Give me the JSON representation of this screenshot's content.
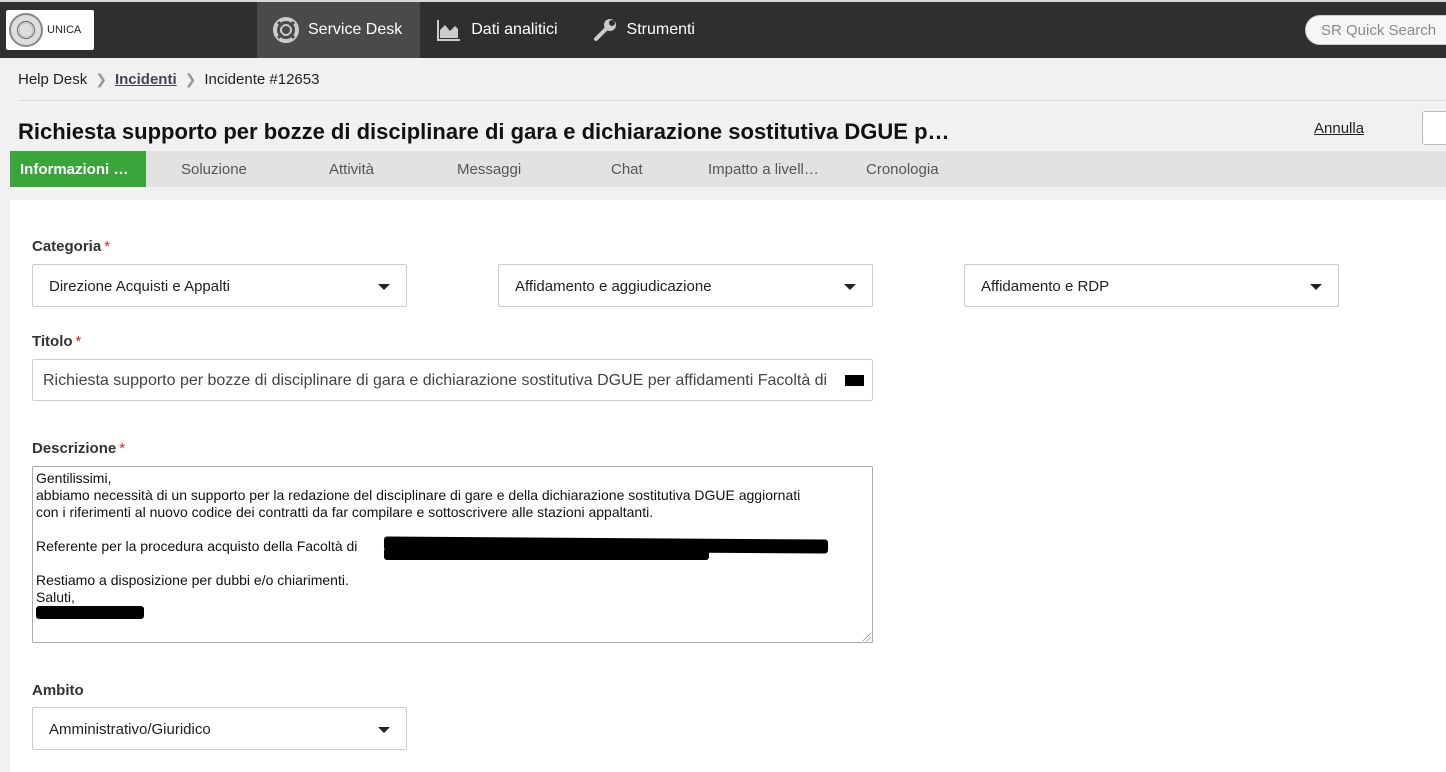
{
  "header": {
    "logo_text": "UNICA",
    "nav": [
      {
        "label": "Service Desk",
        "icon": "lifebuoy-icon"
      },
      {
        "label": "Dati analitici",
        "icon": "area-chart-icon"
      },
      {
        "label": "Strumenti",
        "icon": "wrench-icon"
      }
    ],
    "quick_search_placeholder": "SR Quick Search"
  },
  "breadcrumb": [
    "Help Desk",
    "Incidenti",
    "Incidente #12653"
  ],
  "page": {
    "title": "Richiesta supporto per bozze di disciplinare di gara e dichiarazione sostitutiva DGUE p…",
    "cancel_label": "Annulla"
  },
  "tabs": [
    "Informazioni …",
    "Soluzione",
    "Attività",
    "Messaggi",
    "Chat",
    "Impatto a livell…",
    "Cronologia"
  ],
  "form": {
    "categoria": {
      "label": "Categoria",
      "required_mark": "*",
      "values": [
        "Direzione Acquisti e Appalti",
        "Affidamento e aggiudicazione",
        "Affidamento e RDP"
      ]
    },
    "titolo": {
      "label": "Titolo",
      "required_mark": "*",
      "value": "Richiesta supporto per bozze di disciplinare di gara e dichiarazione sostitutiva DGUE per affidamenti Facoltà di "
    },
    "descrizione": {
      "label": "Descrizione",
      "required_mark": "*",
      "lines": [
        "Gentilissimi,",
        "abbiamo necessità di un supporto per la redazione del disciplinare di gare e della dichiarazione sostitutiva DGUE aggiornati",
        "con i riferimenti al nuovo codice dei contratti da far compilare e sottoscrivere alle stazioni appaltanti.",
        "",
        "Referente per la procedura acquisto della Facoltà di ",
        "",
        "Restiamo a disposizione per dubbi e/o chiarimenti.",
        "Saluti,",
        ""
      ]
    },
    "ambito": {
      "label": "Ambito",
      "value": "Amministrativo/Giuridico"
    }
  },
  "colors": {
    "topbar": "#2f2f2f",
    "active_tab": "#3aa53a",
    "required": "#dd2222"
  }
}
